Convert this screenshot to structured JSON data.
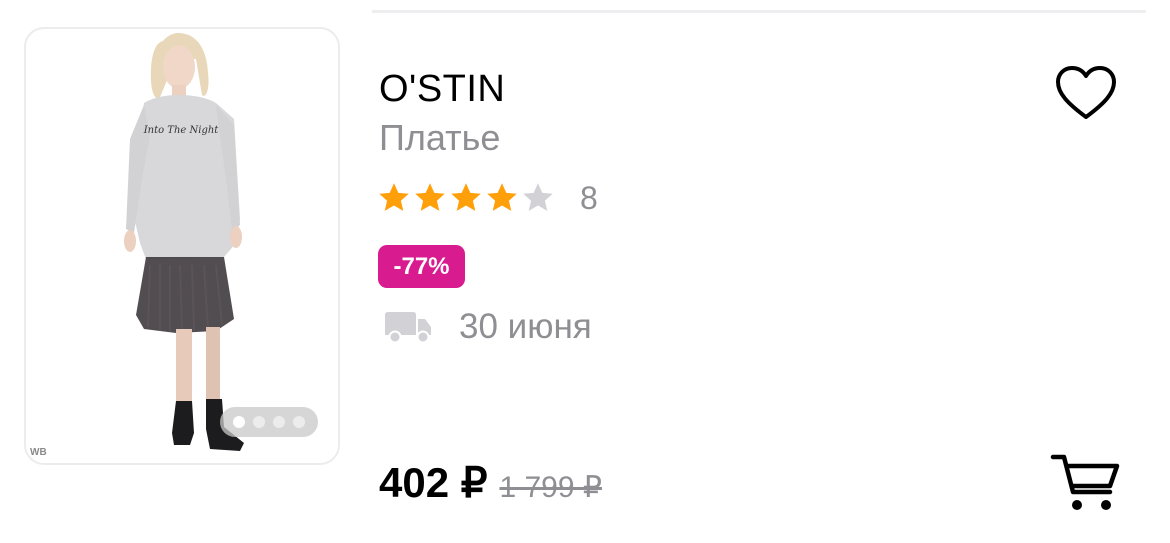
{
  "product": {
    "brand": "O'STIN",
    "type": "Платье",
    "rating": 4,
    "rating_max": 5,
    "reviews_count": "8",
    "discount": "-77%",
    "delivery_date": "30 июня",
    "price_current": "402 ₽",
    "price_old": "1 799 ₽"
  },
  "image": {
    "watermark": "WB",
    "print_text": "Into The Night",
    "slides_count": 4,
    "active_slide": 0
  },
  "icons": {
    "favorite": "heart-icon",
    "cart": "cart-icon",
    "delivery": "truck-icon",
    "star": "star-icon"
  },
  "colors": {
    "star_active": "#ff9f0a",
    "star_inactive": "#d1d1d6",
    "discount_bg": "#d81b8f",
    "muted_text": "#8e8e93"
  }
}
